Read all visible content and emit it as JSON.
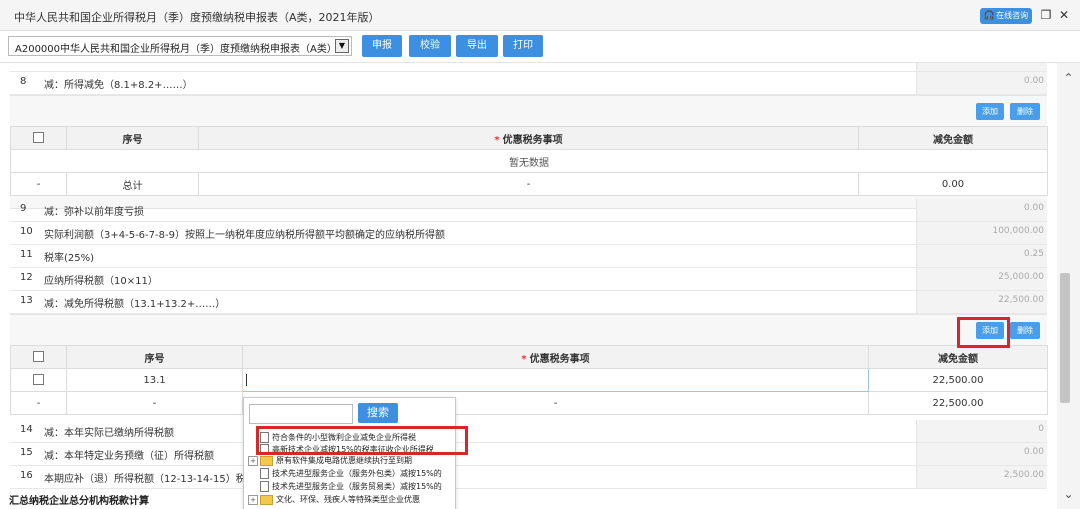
{
  "window": {
    "title": "中华人民共和国企业所得税月（季）度预缴纳税申报表（A类，2021年版）",
    "consult_button": "在线咨询"
  },
  "toolbar": {
    "form_select_value": "A200000中华人民共和国企业所得税月（季）度预缴纳税申报表（A类）",
    "buttons": [
      "申报",
      "校验",
      "导出",
      "打印"
    ]
  },
  "rows": {
    "r8": {
      "num": "8",
      "label": "减：所得减免（8.1+8.2+……）",
      "value": "0.00"
    },
    "r9": {
      "num": "9",
      "label": "减：弥补以前年度亏损",
      "value": "0.00"
    },
    "r10": {
      "num": "10",
      "label": "实际利润额（3+4-5-6-7-8-9）按照上一纳税年度应纳税所得额平均额确定的应纳税所得额",
      "value": "100,000.00"
    },
    "r11": {
      "num": "11",
      "label": "税率(25%)",
      "value": "0.25"
    },
    "r12": {
      "num": "12",
      "label": "应纳所得税额（10×11）",
      "value": "25,000.00"
    },
    "r13": {
      "num": "13",
      "label": "减：减免所得税额（13.1+13.2+……）",
      "value": "22,500.00"
    },
    "r14": {
      "num": "14",
      "label": "减：本年实际已缴纳所得税额",
      "value": "0"
    },
    "r15": {
      "num": "15",
      "label": "减：本年特定业务预缴（征）所得税额",
      "value": "0.00"
    },
    "r16": {
      "num": "16",
      "label": "本期应补（退）所得税额（12-13-14-15）税务",
      "value": "2,500.00"
    }
  },
  "subtable_8": {
    "add_label": "添加",
    "delete_label": "删除",
    "headers": {
      "seq": "序号",
      "item": "优惠税务事项",
      "amount": "减免金额"
    },
    "empty_text": "暂无数据",
    "total": {
      "mark": "-",
      "seq": "总计",
      "item": "-",
      "amount": "0.00"
    }
  },
  "subtable_13": {
    "add_label": "添加",
    "delete_label": "删除",
    "headers": {
      "seq": "序号",
      "item": "优惠税务事项",
      "amount": "减免金额"
    },
    "row1": {
      "seq": "13.1",
      "item": "",
      "amount": "22,500.00"
    },
    "total": {
      "mark": "-",
      "seq": "-",
      "item": "-",
      "amount": "22,500.00"
    }
  },
  "dropdown": {
    "search_placeholder": "",
    "search_button": "搜索",
    "items": [
      "符合条件的小型微利企业减免企业所得税",
      "高新技术企业减按15%的税率征收企业所得税",
      "原有软件集成电路优惠继续执行至到期",
      "技术先进型服务企业（服务外包类）减按15%的",
      "技术先进型服务企业（服务贸易类）减按15%的",
      "文化、环保、残疾人等特殊类型企业优惠"
    ]
  },
  "section": {
    "title": "汇总纳税企业总分机构税款计算"
  }
}
